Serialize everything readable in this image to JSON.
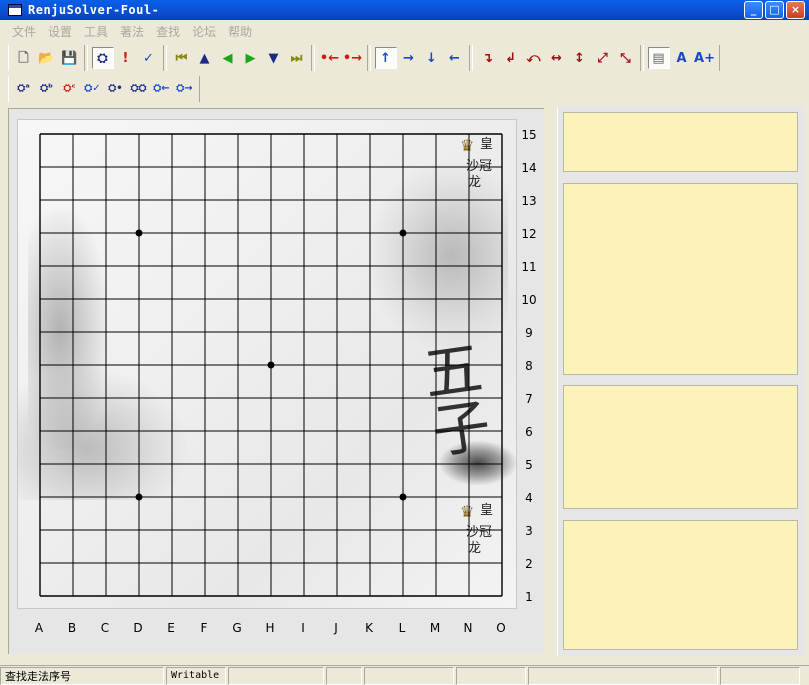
{
  "window": {
    "title": "RenjuSolver-Foul-"
  },
  "window_buttons": {
    "minimize": "_",
    "maximize": "□",
    "close": "×"
  },
  "menu": [
    "文件",
    "设置",
    "工具",
    "著法",
    "查找",
    "论坛",
    "帮助"
  ],
  "toolbar1": {
    "groups": [
      [
        {
          "name": "new-file-icon",
          "glyph": "🗋",
          "cls": "gray",
          "interactable": true
        },
        {
          "name": "open-folder-icon",
          "glyph": "📂",
          "cls": "olive",
          "interactable": true
        },
        {
          "name": "save-icon",
          "glyph": "💾",
          "cls": "gray",
          "interactable": true
        }
      ],
      [
        {
          "name": "binoculars-icon",
          "glyph": "⛭",
          "cls": "navy",
          "state": "sunken",
          "interactable": true
        },
        {
          "name": "exclamation-icon",
          "glyph": "!",
          "cls": "red",
          "interactable": true
        },
        {
          "name": "checkmark-icon",
          "glyph": "✓",
          "cls": "blue",
          "interactable": true
        }
      ],
      [
        {
          "name": "first-move-icon",
          "glyph": "⏮",
          "cls": "olive",
          "interactable": true
        },
        {
          "name": "arrow-up-triangle-icon",
          "glyph": "▲",
          "cls": "navy",
          "interactable": true
        },
        {
          "name": "arrow-left-triangle-icon",
          "glyph": "◀",
          "cls": "green",
          "interactable": true
        },
        {
          "name": "arrow-right-triangle-icon",
          "glyph": "▶",
          "cls": "green",
          "interactable": true
        },
        {
          "name": "arrow-down-triangle-icon",
          "glyph": "▼",
          "cls": "navy",
          "interactable": true
        },
        {
          "name": "last-move-icon",
          "glyph": "⏭",
          "cls": "olive",
          "interactable": true
        }
      ],
      [
        {
          "name": "dot-left-icon",
          "glyph": "•←",
          "cls": "red",
          "interactable": true
        },
        {
          "name": "dot-right-icon",
          "glyph": "•→",
          "cls": "red",
          "interactable": true
        }
      ],
      [
        {
          "name": "shift-up-icon",
          "glyph": "↑",
          "cls": "blue",
          "state": "sunken",
          "interactable": true
        },
        {
          "name": "shift-right-icon",
          "glyph": "→",
          "cls": "blue",
          "interactable": true
        },
        {
          "name": "shift-down-icon",
          "glyph": "↓",
          "cls": "blue",
          "interactable": true
        },
        {
          "name": "shift-left-icon",
          "glyph": "←",
          "cls": "blue",
          "interactable": true
        }
      ],
      [
        {
          "name": "rotate-cw-icon",
          "glyph": "↴",
          "cls": "dred",
          "interactable": true
        },
        {
          "name": "rotate-ccw-icon",
          "glyph": "↲",
          "cls": "dred",
          "interactable": true
        },
        {
          "name": "rotate-180-icon",
          "glyph": "⤺",
          "cls": "dred",
          "interactable": true
        },
        {
          "name": "flip-horizontal-icon",
          "glyph": "↔",
          "cls": "dred",
          "interactable": true
        },
        {
          "name": "flip-vertical-icon",
          "glyph": "↕",
          "cls": "dred",
          "interactable": true
        },
        {
          "name": "flip-diagonal-icon",
          "glyph": "⤢",
          "cls": "dred",
          "interactable": true
        },
        {
          "name": "flip-antidiagonal-icon",
          "glyph": "⤡",
          "cls": "dred",
          "interactable": true
        }
      ],
      [
        {
          "name": "text-box-icon",
          "glyph": "▤",
          "cls": "gray",
          "state": "sunken",
          "interactable": true
        },
        {
          "name": "font-normal-icon",
          "glyph": "A",
          "cls": "blue",
          "interactable": true
        },
        {
          "name": "font-larger-icon",
          "glyph": "A+",
          "cls": "blue",
          "interactable": true
        }
      ]
    ]
  },
  "toolbar2": {
    "buttons": [
      {
        "name": "search-tool-1-icon",
        "glyph": "⛭ᵃ",
        "cls": "navy"
      },
      {
        "name": "search-tool-2-icon",
        "glyph": "⛭ᵇ",
        "cls": "navy"
      },
      {
        "name": "search-tool-3-icon",
        "glyph": "⛭ᶜ",
        "cls": "red"
      },
      {
        "name": "search-tool-4-icon",
        "glyph": "⛭✓",
        "cls": "blue"
      },
      {
        "name": "search-tool-5-icon",
        "glyph": "⛭•",
        "cls": "navy"
      },
      {
        "name": "search-tool-6-icon",
        "glyph": "⛭⛭",
        "cls": "navy"
      },
      {
        "name": "search-tool-7-icon",
        "glyph": "⛭←",
        "cls": "blue"
      },
      {
        "name": "search-tool-8-icon",
        "glyph": "⛭→",
        "cls": "blue"
      }
    ]
  },
  "board": {
    "size": 15,
    "columns": [
      "A",
      "B",
      "C",
      "D",
      "E",
      "F",
      "G",
      "H",
      "I",
      "J",
      "K",
      "L",
      "M",
      "N",
      "O"
    ],
    "rows": [
      "15",
      "14",
      "13",
      "12",
      "11",
      "10",
      "9",
      "8",
      "7",
      "6",
      "5",
      "4",
      "3",
      "2",
      "1"
    ],
    "star_points": [
      "D12",
      "L12",
      "H8",
      "D4",
      "L4"
    ],
    "calligraphy": "五子",
    "logo_top": [
      "皇",
      "沙冠",
      "龙"
    ],
    "logo_bottom": [
      "皇",
      "沙冠",
      "龙"
    ]
  },
  "status": [
    "查找走法序号",
    "Writable",
    "",
    "",
    "",
    "",
    "",
    ""
  ],
  "colors": {
    "panel_yellow": "#fbf3b9",
    "titlebar_blue": "#0a5fe8"
  }
}
